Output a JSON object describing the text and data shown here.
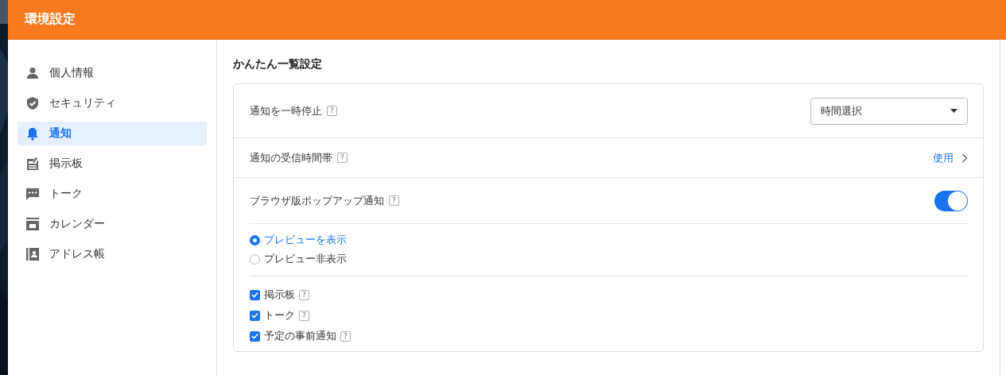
{
  "window": {
    "title": "環境設定"
  },
  "sidebar": {
    "items": [
      {
        "label": "個人情報",
        "selected": false
      },
      {
        "label": "セキュリティ",
        "selected": false
      },
      {
        "label": "通知",
        "selected": true
      },
      {
        "label": "掲示板",
        "selected": false
      },
      {
        "label": "トーク",
        "selected": false
      },
      {
        "label": "カレンダー",
        "selected": false
      },
      {
        "label": "アドレス帳",
        "selected": false
      }
    ]
  },
  "section_title": "かんたん一覧設定",
  "settings": [
    {
      "kind": "dropdown",
      "label": "通知を一時停止",
      "help": "?",
      "value": "時間選択"
    },
    {
      "kind": "link",
      "label": "通知の受信時間帯",
      "help": "?",
      "value": "使用"
    },
    {
      "kind": "toggle",
      "label": "ブラウザ版ポップアップ通知",
      "help": "?",
      "on": true,
      "options": [
        {
          "label": "プレビューを表示",
          "selected": true
        },
        {
          "label": "プレビュー非表示",
          "selected": false
        }
      ],
      "checks": [
        {
          "label": "掲示板",
          "help": "?",
          "checked": true
        },
        {
          "label": "トーク",
          "help": "?",
          "checked": true
        },
        {
          "label": "予定の事前通知",
          "help": "?",
          "checked": true
        }
      ]
    }
  ]
}
